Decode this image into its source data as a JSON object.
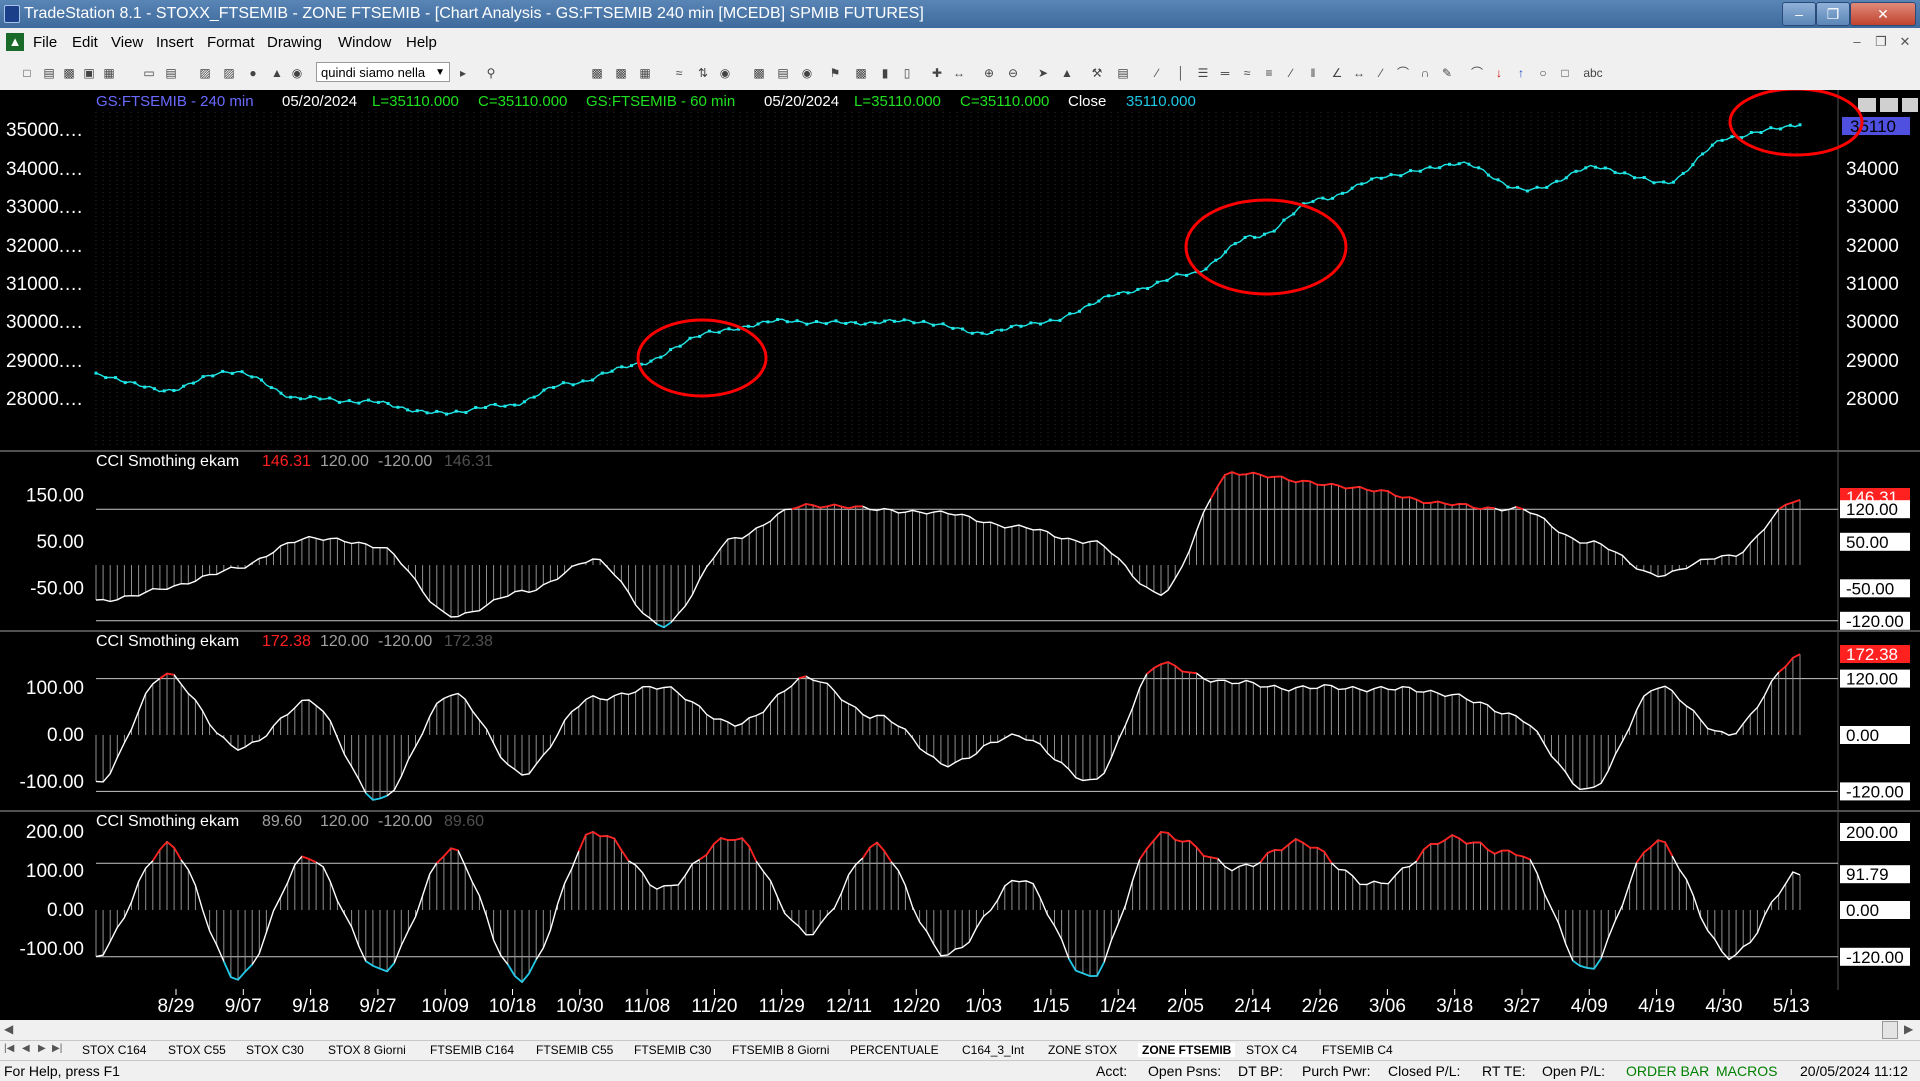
{
  "window": {
    "title": "TradeStation 8.1 - STOXX_FTSEMIB - ZONE FTSEMIB - [Chart Analysis - GS:FTSEMIB  240 min  [MCEDB] SPMIB FUTURES]"
  },
  "menu": [
    "File",
    "Edit",
    "View",
    "Insert",
    "Format",
    "Drawing",
    "Window",
    "Help"
  ],
  "toolbar": {
    "combo_value": "quindi siamo nella"
  },
  "chart_header": {
    "sym1": "GS:FTSEMIB - 240 min",
    "date1": "05/20/2024",
    "low1": "L=35110.000",
    "close1": "C=35110.000",
    "sym2": "GS:FTSEMIB - 60 min",
    "date2": "05/20/2024",
    "low2": "L=35110.000",
    "close2": "C=35110.000",
    "close_label": "Close",
    "close_value": "35110.000"
  },
  "colors": {
    "background": "#000000",
    "price": "#1ee6e6",
    "osc_line": "#ffffff",
    "osc_hist": "#909090",
    "overbought": "#ff2020",
    "oversold": "#1ec8e6",
    "threshold": "#c8c8c8",
    "header_blue": "#6a6aff",
    "header_green": "#20e020",
    "annotation": "#ff0000",
    "axis_text": "#ffffff"
  },
  "icons": {
    "titlebar": "tradestation-icon",
    "minimize": "minimize-icon",
    "restore": "restore-icon",
    "close": "close-icon"
  },
  "price_axis_labels": [
    "35000.…",
    "34000.…",
    "33000.…",
    "32000.…",
    "31000.…",
    "30000.…",
    "29000.…",
    "28000.…"
  ],
  "price_axis_right": [
    "34000",
    "33000",
    "32000",
    "31000",
    "30000",
    "29000",
    "28000"
  ],
  "price_tag": "35110",
  "date_labels": [
    "8/29",
    "9/07",
    "9/18",
    "9/27",
    "10/09",
    "10/18",
    "10/30",
    "11/08",
    "11/20",
    "11/29",
    "12/11",
    "12/20",
    "1/03",
    "1/15",
    "1/24",
    "2/05",
    "2/14",
    "2/26",
    "3/06",
    "3/18",
    "3/27",
    "4/09",
    "4/19",
    "4/30",
    "5/13"
  ],
  "sheet_tabs": [
    "STOX C164",
    "STOX C55",
    "STOX  C30",
    "STOX  8 Giorni",
    "FTSEMIB C164",
    "FTSEMIB C55",
    "FTSEMIB C30",
    "FTSEMIB  8 Giorni",
    "PERCENTUALE",
    "C164_3_Int",
    "ZONE STOX",
    "ZONE FTSEMIB",
    "STOX  C4",
    "FTSEMIB C4"
  ],
  "active_tab": "ZONE FTSEMIB",
  "status": {
    "help": "For Help, press F1",
    "acct": "Acct:",
    "open_psns": "Open Psns:",
    "dt_bp": "DT BP:",
    "purch_pwr": "Purch Pwr:",
    "closed_pl": "Closed P/L:",
    "rt_te": "RT TE:",
    "open_pl": "Open P/L:",
    "order_bar": "ORDER BAR",
    "macros": "MACROS",
    "datetime": "20/05/2024 11:12"
  },
  "chart_data": [
    {
      "type": "line",
      "title": "GS:FTSEMIB - 240 min",
      "x": [
        "8/29",
        "9/07",
        "9/18",
        "9/27",
        "10/09",
        "10/18",
        "10/30",
        "11/08",
        "11/20",
        "11/29",
        "12/11",
        "12/20",
        "1/03",
        "1/15",
        "1/24",
        "2/05",
        "2/14",
        "2/26",
        "3/06",
        "3/18",
        "3/27",
        "4/09",
        "4/19",
        "4/30",
        "5/13"
      ],
      "series": [
        {
          "values": [
            28600,
            28200,
            28700,
            28000,
            27900,
            27600,
            27800,
            28400,
            28900,
            29700,
            30000,
            29950,
            30000,
            29700,
            30000,
            30700,
            31200,
            32200,
            33200,
            33800,
            34100,
            33400,
            34000,
            33600,
            34800
          ]
        }
      ],
      "last": 35110,
      "ylim": [
        27000,
        36000
      ],
      "grid": true
    },
    {
      "type": "line",
      "title": "CCI Smothing ekam",
      "readouts": [
        "146.31",
        "120.00",
        "-120.00",
        "146.31"
      ],
      "levels": [
        120,
        -120
      ],
      "tick_labels": [
        "150.00",
        "50.00",
        "-50.00"
      ],
      "axis_tags": [
        "146.31",
        "120.00",
        "50.00",
        "-50.00",
        "-120.00"
      ],
      "values": [
        -80,
        -50,
        -5,
        60,
        40,
        -110,
        -60,
        10,
        -130,
        60,
        130,
        120,
        110,
        80,
        50,
        -60,
        200,
        180,
        160,
        130,
        120,
        50,
        -20,
        20,
        140
      ],
      "ylim": [
        -160,
        230
      ]
    },
    {
      "type": "line",
      "title": "CCI Smothing ekam",
      "readouts": [
        "172.38",
        "120.00",
        "-120.00",
        "172.38"
      ],
      "levels": [
        120,
        -120
      ],
      "tick_labels": [
        "100.00",
        "0.00",
        "-100.00"
      ],
      "axis_tags": [
        "172.38",
        "120.00",
        "0.00",
        "-120.00"
      ],
      "values": [
        -100,
        130,
        -30,
        70,
        -140,
        90,
        -80,
        80,
        100,
        20,
        120,
        40,
        -60,
        0,
        -100,
        150,
        110,
        100,
        100,
        90,
        40,
        -120,
        100,
        0,
        172
      ],
      "ylim": [
        -160,
        210
      ]
    },
    {
      "type": "line",
      "title": "CCI Smothing ekam",
      "readouts": [
        "89.60",
        "120.00",
        "-120.00",
        "89.60"
      ],
      "levels": [
        120,
        -120
      ],
      "tick_labels": [
        "200.00",
        "100.00",
        "0.00",
        "-100.00"
      ],
      "axis_tags": [
        "200.00",
        "91.79",
        "0.00",
        "-120.00"
      ],
      "values": [
        -120,
        170,
        -170,
        140,
        -160,
        150,
        -180,
        200,
        60,
        190,
        -60,
        160,
        -120,
        80,
        -170,
        200,
        110,
        170,
        60,
        180,
        150,
        -150,
        180,
        -120,
        90
      ],
      "ylim": [
        -200,
        230
      ]
    }
  ]
}
